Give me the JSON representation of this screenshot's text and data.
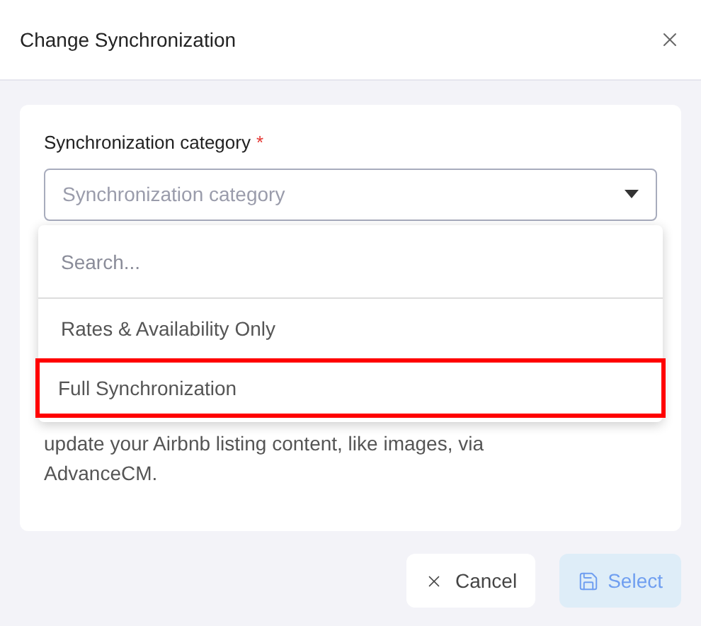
{
  "dialog": {
    "title": "Change Synchronization"
  },
  "field": {
    "label": "Synchronization category",
    "required_mark": "*",
    "placeholder": "Synchronization category",
    "expanded": true
  },
  "dropdown": {
    "search_placeholder": "Search...",
    "options": [
      {
        "label": "Rates & Availability Only",
        "highlighted": false
      },
      {
        "label": "Full Synchronization",
        "highlighted": true
      }
    ]
  },
  "description": [
    "update your Airbnb listing content, like images, via",
    "AdvanceCM."
  ],
  "buttons": [
    {
      "label": "Cancel",
      "kind": "cancel",
      "disabled": false
    },
    {
      "label": "Select",
      "kind": "save",
      "disabled": true
    }
  ]
}
